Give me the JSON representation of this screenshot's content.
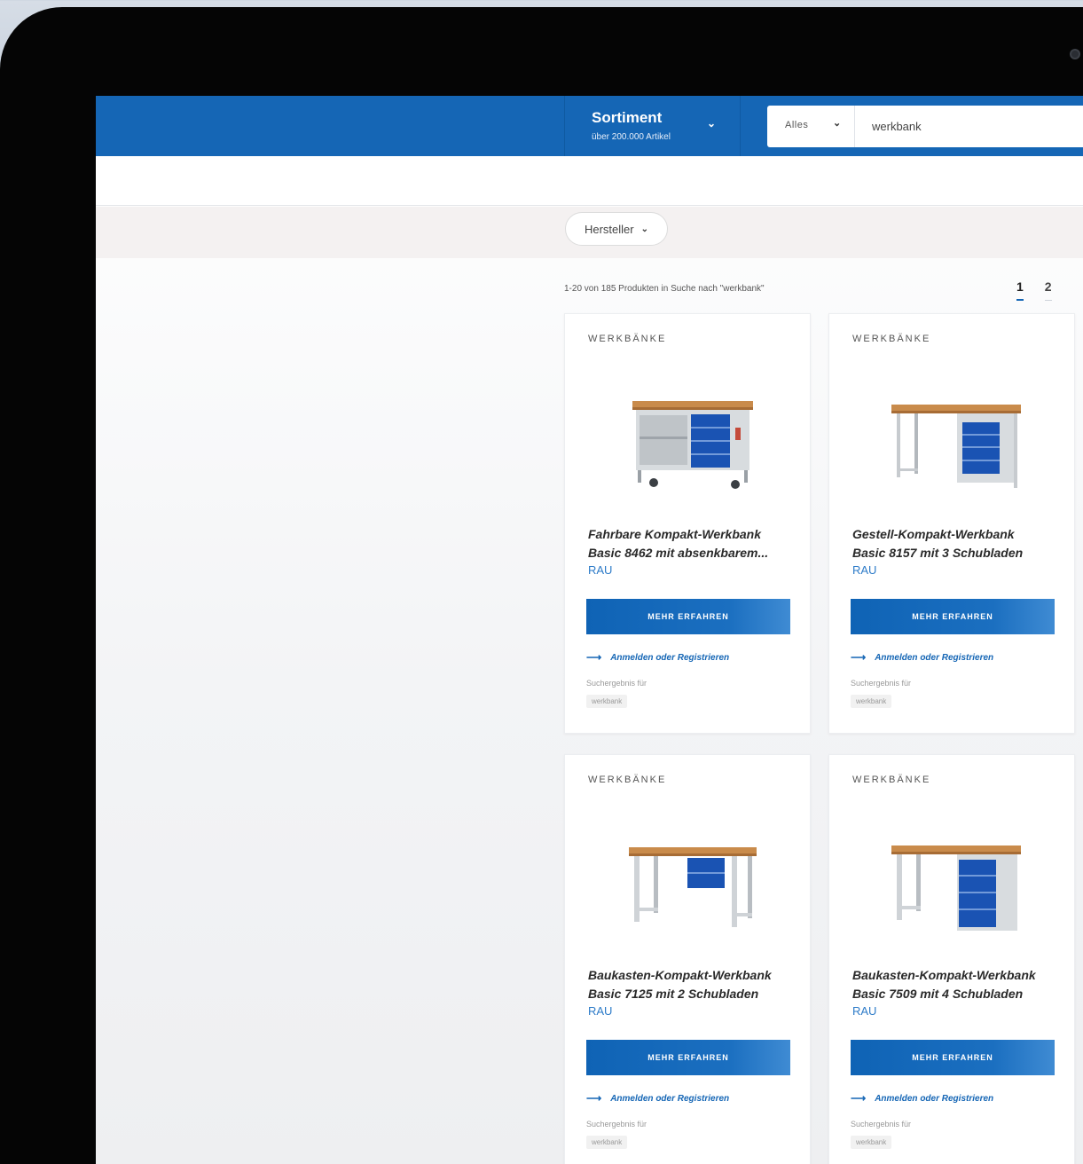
{
  "header": {
    "sortiment_title": "Sortiment",
    "sortiment_sub": "über 200.000 Artikel",
    "search_category": "Alles",
    "search_query": "werkbank"
  },
  "filters": {
    "manufacturer_label": "Hersteller"
  },
  "results": {
    "info": "1-20 von 185 Produkten in Suche nach \"werkbank\"",
    "pages": [
      "1",
      "2"
    ]
  },
  "products": [
    {
      "category": "WERKBÄNKE",
      "name_line1": "Fahrbare Kompakt-Werkbank",
      "name_line2": "Basic 8462 mit absenkbarem...",
      "brand": "RAU",
      "button": "MEHR ERFAHREN",
      "login": "Anmelden oder Registrieren",
      "hint": "Suchergebnis für",
      "tag": "werkbank"
    },
    {
      "category": "WERKBÄNKE",
      "name_line1": "Gestell-Kompakt-Werkbank",
      "name_line2": "Basic 8157 mit 3 Schubladen",
      "brand": "RAU",
      "button": "MEHR ERFAHREN",
      "login": "Anmelden oder Registrieren",
      "hint": "Suchergebnis für",
      "tag": "werkbank"
    },
    {
      "category": "WERKBÄNKE",
      "name_line1": "Baukasten-Kompakt-Werkbank",
      "name_line2": "Basic 7125 mit 2 Schubladen",
      "brand": "RAU",
      "button": "MEHR ERFAHREN",
      "login": "Anmelden oder Registrieren",
      "hint": "Suchergebnis für",
      "tag": "werkbank"
    },
    {
      "category": "WERKBÄNKE",
      "name_line1": "Baukasten-Kompakt-Werkbank",
      "name_line2": "Basic 7509 mit 4 Schubladen",
      "brand": "RAU",
      "button": "MEHR ERFAHREN",
      "login": "Anmelden oder Registrieren",
      "hint": "Suchergebnis für",
      "tag": "werkbank"
    }
  ],
  "colors": {
    "brand_blue": "#1566b5",
    "link_blue": "#2d7bc8",
    "bezel": "#050505"
  }
}
